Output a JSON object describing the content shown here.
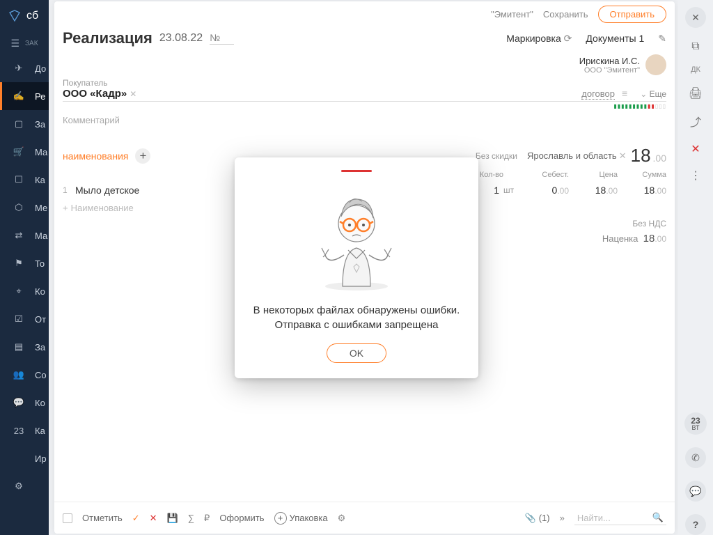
{
  "header": {
    "issuer": "\"Эмитент\"",
    "save": "Сохранить",
    "send": "Отправить"
  },
  "doc": {
    "title": "Реализация",
    "date": "23.08.22",
    "num_label": "№",
    "marking": "Маркировка",
    "documents_label": "Документы",
    "documents_count": "1"
  },
  "user": {
    "name": "Ирискина И.С.",
    "org": "ООО \"Эмитент\""
  },
  "buyer": {
    "label": "Покупатель",
    "name": "ООО «Кадр»",
    "contract": "договор",
    "more": "Еще"
  },
  "comment_placeholder": "Комментарий",
  "items": {
    "tab": "наименования",
    "no_discount": "Без скидки",
    "region": "Ярославль и область",
    "total_int": "18",
    "total_dec": ".00",
    "cols": {
      "qty": "Кол-во",
      "cost": "Себест.",
      "price": "Цена",
      "sum": "Сумма"
    },
    "row1": {
      "idx": "1",
      "name": "Мыло детское",
      "qty": "1",
      "unit": "шт",
      "cost_int": "0",
      "cost_dec": ".00",
      "price_int": "18",
      "price_dec": ".00",
      "sum_int": "18",
      "sum_dec": ".00"
    },
    "add_placeholder": "Наименование",
    "without_vat": "Без НДС",
    "markup_label": "Наценка",
    "markup_int": "18",
    "markup_dec": ".00"
  },
  "bottombar": {
    "mark": "Отметить",
    "format": "Оформить",
    "pack": "Упаковка",
    "attach_count": "(1)",
    "search": "Найти..."
  },
  "sidebar": {
    "brand": "сб",
    "section": "ЗАК",
    "items": [
      "До",
      "Ре",
      "За",
      "Ма",
      "Ка",
      "Ме",
      "Ма",
      "То",
      "Ко",
      "От",
      "За",
      "Со",
      "Ко",
      "Ка",
      "Ир"
    ],
    "cal": "23"
  },
  "rail": {
    "dk": "ДК",
    "date_num": "23",
    "date_day": "ВТ"
  },
  "modal": {
    "text": "В некоторых файлах обнаружены ошибки. Отправка с ошибками запрещена",
    "ok": "OK"
  }
}
